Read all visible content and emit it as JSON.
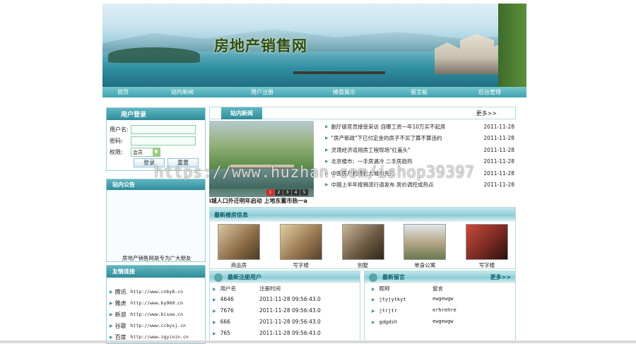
{
  "site": {
    "title": "房地产销售网"
  },
  "nav": [
    "首页",
    "站内新闻",
    "用户注册",
    "楼盘展示",
    "留言板",
    "后台管理"
  ],
  "login": {
    "title": "用户登录",
    "username_label": "用户名:",
    "username_value": "",
    "password_label": "密码:",
    "password_value": "",
    "role_label": "权限:",
    "role_value": "会员",
    "login_button": "登录",
    "reset_button": "重置"
  },
  "notice": {
    "title": "站内公告",
    "text": "房地产销售网是专为广大朋友"
  },
  "links": {
    "title": "友情连接",
    "items": [
      {
        "name": "腾讯",
        "url": "http://www.cnby8.cn"
      },
      {
        "name": "雅虎",
        "url": "http://www.by960.cn"
      },
      {
        "name": "新浪",
        "url": "http://www.bisow.cn"
      },
      {
        "name": "谷歌",
        "url": "http://www.ccbysj.cn"
      },
      {
        "name": "百度",
        "url": "http://www.zgyinin.cn"
      }
    ]
  },
  "news": {
    "title": "站内新闻",
    "more": "更多>>",
    "caption": "i城人口外迁明年启动 上地东蓄市热一a",
    "pager": [
      "1",
      "2",
      "3",
      "4",
      "5"
    ],
    "items": [
      {
        "title": "副厅级官员接受采访 自曝工资一年10万买不起房",
        "date": "2011-11-28"
      },
      {
        "title": "\"房产新政\"下已付定金的房子不买了算不算违约",
        "date": "2011-11-28"
      },
      {
        "title": "灵境经济适用房工程现场\"红盖头\"",
        "date": "2011-11-28"
      },
      {
        "title": "北京楼市：一手房遇冷 二手房趋热",
        "date": "2011-11-28"
      },
      {
        "title": "中国房产税将在大城市先行",
        "date": "2011-11-28"
      },
      {
        "title": "中国上半年按揭流行语发布 房价调控成热点",
        "date": "2011-11-28"
      }
    ]
  },
  "properties": {
    "title": "最新楼房信息",
    "items": [
      {
        "name": "商品房",
        "color": "#8a6a44"
      },
      {
        "name": "写字楼",
        "color": "#9c7b52"
      },
      {
        "name": "别墅",
        "color": "#6d5a43"
      },
      {
        "name": "单身公寓",
        "color": "#b7a88a"
      },
      {
        "name": "写字楼",
        "color": "#7a2a22"
      }
    ]
  },
  "users": {
    "title": "最新注册用户",
    "col_user": "用户名",
    "col_time": "注册时间",
    "rows": [
      {
        "name": "4646",
        "time": "2011-11-28 09:56:43.0"
      },
      {
        "name": "7676",
        "time": "2011-11-28 09:56:43.0"
      },
      {
        "name": "666",
        "time": "2011-11-28 09:56:43.0"
      },
      {
        "name": "765",
        "time": "2011-11-28 09:56:43.0"
      }
    ]
  },
  "messages": {
    "title": "最新留言",
    "more": "更多>>",
    "col_nick": "昵称",
    "col_msg": "留言",
    "rows": [
      {
        "nick": "jtyjytkyt",
        "msg": "ewgewgw"
      },
      {
        "nick": "jtrjtr",
        "msg": "erhrehre"
      },
      {
        "nick": "gdgdsh",
        "msg": "ewgewgw"
      }
    ]
  },
  "watermark": "https://www.huzhan.com/ishop39397"
}
